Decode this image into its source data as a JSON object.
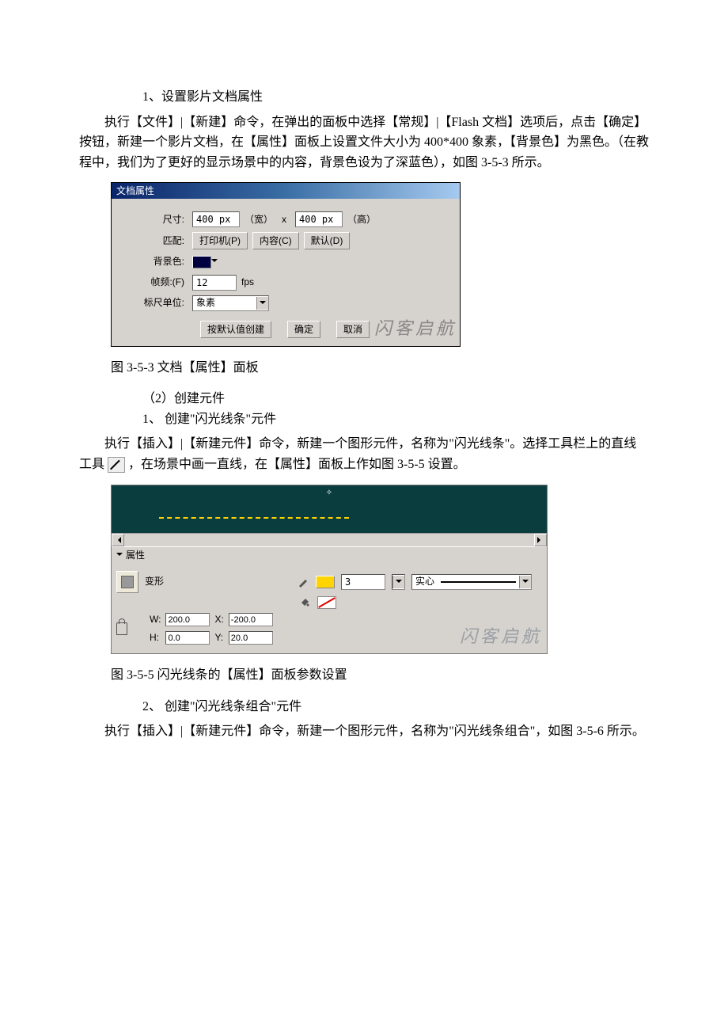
{
  "doc": {
    "step1_title": "1、设置影片文档属性",
    "step1_para": "执行【文件】|【新建】命令，在弹出的面板中选择【常规】|【Flash 文档】选项后，点击【确定】按钮，新建一个影片文档，在【属性】面板上设置文件大小为 400*400 象素，【背景色】为黑色。（在教程中，我们为了更好的显示场景中的内容，背景色设为了深蓝色），如图 3-5-3 所示。",
    "fig353_caption": "图 3-5-3 文档【属性】面板",
    "step2a_title": "（2）创建元件",
    "step2a_item1": "1、 创建\"闪光线条\"元件",
    "step2a_para_pre": "执行【插入】|【新建元件】命令，新建一个图形元件，名称为\"闪光线条\"。选择工具栏上的直线工具",
    "step2a_para_post": "，在场景中画一直线，在【属性】面板上作如图 3-5-5 设置。",
    "fig355_caption": "图 3-5-5 闪光线条的【属性】面板参数设置",
    "step2a_item2": "2、 创建\"闪光线条组合\"元件",
    "step2a_para2": "执行【插入】|【新建元件】命令，新建一个图形元件，名称为\"闪光线条组合\"，如图 3-5-6 所示。"
  },
  "dlg1": {
    "title": "文档属性",
    "size_label": "尺寸:",
    "width_value": "400 px",
    "width_suffix": "（宽）",
    "x": "x",
    "height_value": "400 px",
    "height_suffix": "（高）",
    "match_label": "匹配:",
    "btn_printer": "打印机(P)",
    "btn_content": "内容(C)",
    "btn_default": "默认(D)",
    "bg_label": "背景色:",
    "fps_label": "帧频:(F)",
    "fps_value": "12",
    "fps_unit": "fps",
    "ruler_label": "标尺单位:",
    "ruler_value": "象素",
    "btn_create_default": "按默认值创建",
    "btn_ok": "确定",
    "btn_cancel": "取消",
    "watermark": "闪客启航"
  },
  "panel2": {
    "header": "属性",
    "shape_label": "变形",
    "stroke_weight": "3",
    "style_label": "实心",
    "W_label": "W:",
    "W_value": "200.0",
    "X_label": "X:",
    "X_value": "-200.0",
    "H_label": "H:",
    "H_value": "0.0",
    "Y_label": "Y:",
    "Y_value": "20.0",
    "watermark": "闪客启航"
  }
}
